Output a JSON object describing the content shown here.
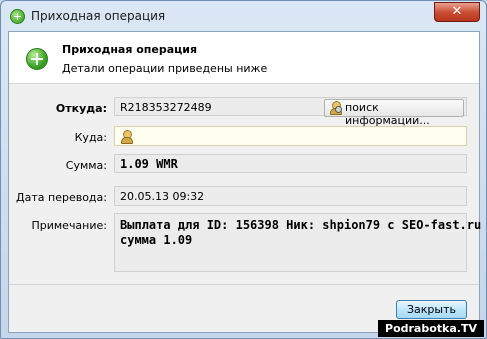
{
  "window": {
    "title": "Приходная операция",
    "close_glyph": "✕"
  },
  "header": {
    "title": "Приходная операция",
    "subtitle": "Детали операции приведены ниже"
  },
  "form": {
    "from": {
      "label": "Откуда:",
      "value": "R218353272489",
      "search_label": "поиск информации..."
    },
    "to": {
      "label": "Куда:",
      "value": ""
    },
    "amount": {
      "label": "Сумма:",
      "value": "1.09 WMR"
    },
    "date": {
      "label": "Дата перевода:",
      "value": "20.05.13 09:32"
    },
    "note": {
      "label": "Примечание:",
      "line1": "Выплата для ID: 156398 Ник: shpion79 с SEO-fast.ru",
      "line2": "сумма 1.09"
    }
  },
  "footer": {
    "close_label": "Закрыть"
  },
  "watermark": "Podrabotka.TV",
  "icons": {
    "title": "add-green-icon",
    "header": "add-green-icon",
    "person": "person-search-icon"
  },
  "colors": {
    "accent_green": "#2e9b1c",
    "close_red": "#c94a31",
    "button_blue": "#bee6fd"
  }
}
